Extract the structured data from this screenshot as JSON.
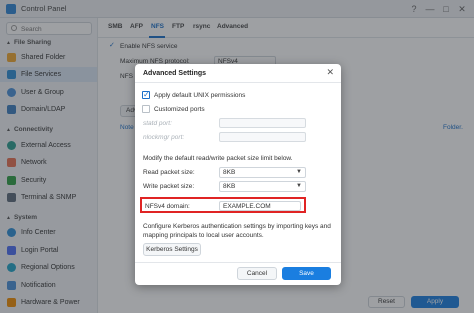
{
  "window": {
    "title": "Control Panel",
    "controls": [
      "?",
      "—",
      "□",
      "✕"
    ]
  },
  "sidebar": {
    "search_placeholder": "Search",
    "sections": [
      {
        "label": "File Sharing"
      },
      {
        "label": "Connectivity"
      },
      {
        "label": "System"
      }
    ],
    "items": [
      {
        "label": "Shared Folder",
        "icon": "folder-icon",
        "color": "#f0a830"
      },
      {
        "label": "File Services",
        "icon": "file-services-icon",
        "color": "#2d8fd8"
      },
      {
        "label": "User & Group",
        "icon": "users-icon",
        "color": "#4a90d9"
      },
      {
        "label": "Domain/LDAP",
        "icon": "domain-icon",
        "color": "#3c7fc0"
      },
      {
        "label": "External Access",
        "icon": "globe-icon",
        "color": "#2a9d8f"
      },
      {
        "label": "Network",
        "icon": "network-icon",
        "color": "#e76f51"
      },
      {
        "label": "Security",
        "icon": "shield-icon",
        "color": "#2f9e44"
      },
      {
        "label": "Terminal & SNMP",
        "icon": "terminal-icon",
        "color": "#5c6b7a"
      },
      {
        "label": "Info Center",
        "icon": "info-icon",
        "color": "#2d8fd8"
      },
      {
        "label": "Login Portal",
        "icon": "portal-icon",
        "color": "#4c6ef5"
      },
      {
        "label": "Regional Options",
        "icon": "clock-icon",
        "color": "#20a4c9"
      },
      {
        "label": "Notification",
        "icon": "notification-icon",
        "color": "#4a90d9"
      },
      {
        "label": "Hardware & Power",
        "icon": "power-icon",
        "color": "#f08c00"
      }
    ]
  },
  "content": {
    "tabs": [
      "SMB",
      "AFP",
      "NFS",
      "FTP",
      "rsync",
      "Advanced"
    ],
    "active_tab": "NFS",
    "enable_nfs_label": "Enable NFS service",
    "max_protocol_label": "Maximum NFS protocol:",
    "max_protocol_value": "NFSv4",
    "nfs_label_fragment": "NFS",
    "adv_button_fragment": "Adv",
    "note_fragment": "Note",
    "folder_link_fragment": "Folder."
  },
  "footer": {
    "reset": "Reset",
    "apply": "Apply"
  },
  "modal": {
    "title": "Advanced Settings",
    "close": "✕",
    "apply_unix_permissions": "Apply default UNIX permissions",
    "customized_ports": "Customized ports",
    "statd_port_label": "statd port:",
    "nlockmgr_port_label": "nlockmgr port:",
    "packet_size_heading": "Modify the default read/write packet size limit below.",
    "read_packet_label": "Read packet size:",
    "read_packet_value": "8KB",
    "write_packet_label": "Write packet size:",
    "write_packet_value": "8KB",
    "nfsv4_domain_label": "NFSv4 domain:",
    "nfsv4_domain_value": "EXAMPLE.COM",
    "kerberos_text_line1": "Configure Kerberos authentication settings by importing keys and",
    "kerberos_text_line2": "mapping principals to local user accounts.",
    "kerberos_button": "Kerberos Settings",
    "cancel": "Cancel",
    "save": "Save"
  },
  "colors": {
    "accent": "#1a7ee0",
    "highlight": "#e02424"
  }
}
